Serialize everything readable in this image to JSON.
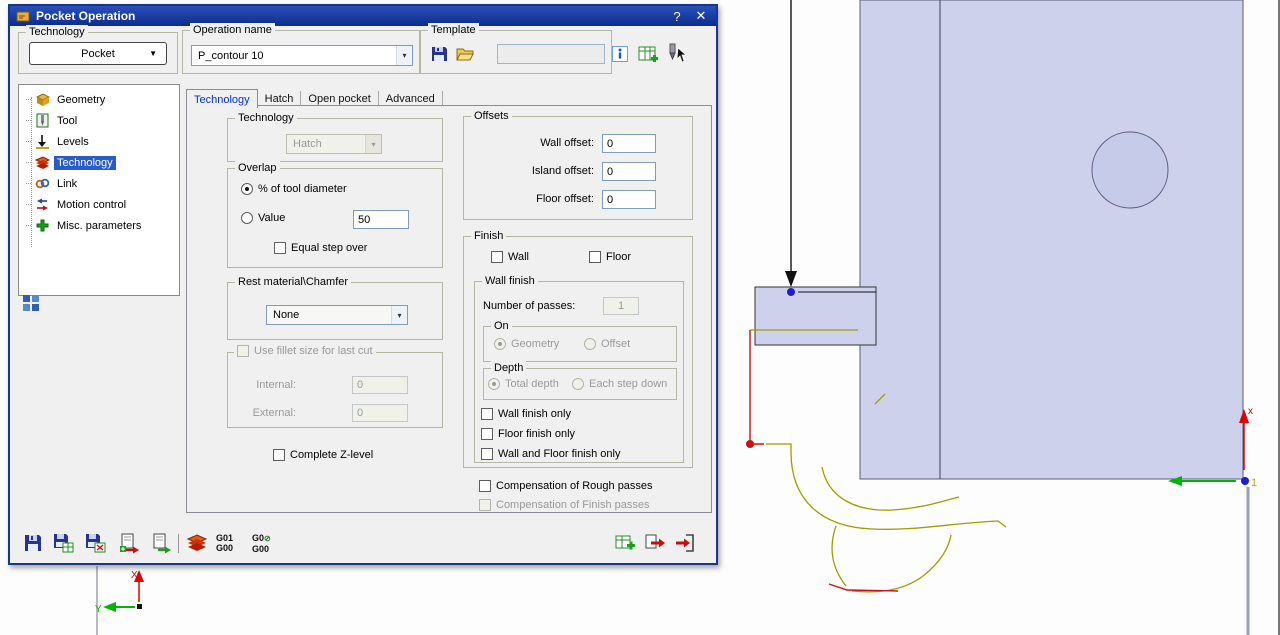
{
  "colors": {
    "titlebar_blue": "#0c2c8c",
    "selection_blue": "#2a5cc8",
    "part_lavender": "#cdd1ec",
    "geometry_olive": "#9aa000",
    "geometry_red": "#cc1111",
    "axis_red": "#e00000",
    "axis_green": "#00b400",
    "dot_blue": "#1d1dcb"
  },
  "window": {
    "title": "Pocket Operation",
    "help_label": "?",
    "close_label": "✕"
  },
  "header": {
    "technology": {
      "label": "Technology",
      "value": "Pocket"
    },
    "operation_name": {
      "label": "Operation name",
      "value": "P_contour 10"
    },
    "template": {
      "label": "Template",
      "value": ""
    }
  },
  "tree": {
    "items": [
      {
        "label": "Geometry"
      },
      {
        "label": "Tool"
      },
      {
        "label": "Levels"
      },
      {
        "label": "Technology"
      },
      {
        "label": "Link"
      },
      {
        "label": "Motion control"
      },
      {
        "label": "Misc. parameters"
      }
    ]
  },
  "tabs": {
    "items": [
      {
        "label": "Technology"
      },
      {
        "label": "Hatch"
      },
      {
        "label": "Open pocket"
      },
      {
        "label": "Advanced"
      }
    ]
  },
  "tech_tab": {
    "technology_group": {
      "label": "Technology",
      "combo_value": "Hatch"
    },
    "overlap": {
      "label": "Overlap",
      "percent_radio": "% of tool diameter",
      "value_radio": "Value",
      "value_field": "50",
      "equal_step": "Equal step over"
    },
    "rest_material": {
      "label": "Rest material\\Chamfer",
      "combo_value": "None"
    },
    "fillet": {
      "caption": "Use fillet size for last cut",
      "internal_label": "Internal:",
      "internal_value": "0",
      "external_label": "External:",
      "external_value": "0"
    },
    "complete_z": "Complete Z-level",
    "offsets": {
      "label": "Offsets",
      "rows": [
        {
          "label": "Wall offset:",
          "value": "0"
        },
        {
          "label": "Island offset:",
          "value": "0"
        },
        {
          "label": "Floor offset:",
          "value": "0"
        }
      ]
    },
    "finish": {
      "label": "Finish",
      "wall": "Wall",
      "floor": "Floor",
      "wall_finish": {
        "label": "Wall finish",
        "passes_label": "Number of passes:",
        "passes_value": "1",
        "on": {
          "label": "On",
          "geometry": "Geometry",
          "offset": "Offset"
        },
        "depth": {
          "label": "Depth",
          "total": "Total depth",
          "each_step": "Each step down"
        },
        "wall_only": "Wall finish only",
        "floor_only": "Floor finish only",
        "wall_floor_only": "Wall and Floor finish only"
      },
      "comp_rough": "Compensation of Rough  passes",
      "comp_finish": "Compensation of Finish passes"
    }
  },
  "gcode": {
    "g01": "G01",
    "g00": "G00",
    "g0": "G0",
    "g0_mark": "⊘",
    "g00b": "G00"
  },
  "viewport": {
    "axis_x_label": "X",
    "axis_y_label": "Y",
    "axis_x_small": "x",
    "ucs_label": "1"
  },
  "icons": {
    "operation-icon": "pocket",
    "save-icon": "floppy",
    "open-template-icon": "folder",
    "info-icon": "info-square",
    "template-table-icon": "table-plus",
    "pick-tool-icon": "tool-cursor",
    "tree-geometry-icon": "cube",
    "tree-tool-icon": "drill",
    "tree-levels-icon": "down-arrow",
    "tree-technology-icon": "red-layers",
    "tree-link-icon": "chain",
    "tree-motion-icon": "arrows",
    "tree-misc-icon": "green-plus",
    "grid-icon": "blue-squares",
    "toolbar-save-icon": "floppy",
    "toolbar-save-template-icon": "floppy-table",
    "toolbar-save-defaults-icon": "floppy-grid",
    "toolbar-copy-red-icon": "page-red-arrow",
    "toolbar-copy-green-icon": "page-green-arrow",
    "toolbar-technology-icon": "red-layers",
    "g0-circle-icon": "slashed-circle",
    "add-operation-icon": "table-plus",
    "save-copy-icon": "page-red-arrow",
    "save-exit-icon": "door-red-arrow",
    "chevron-down-icon": "▼",
    "combo-arrow-icon": "▾"
  }
}
